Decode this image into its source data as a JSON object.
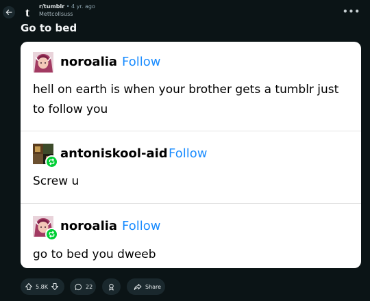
{
  "header": {
    "subreddit": "r/tumblr",
    "separator": "•",
    "age": "4 yr. ago",
    "author": "Mettcollsuss",
    "more": "•••"
  },
  "post": {
    "title": "Go to bed"
  },
  "tumblr": {
    "follow_label": "Follow",
    "blocks": [
      {
        "username": "noroalia",
        "text_line1": "hell on earth is when your brother gets a tumblr just",
        "text_line2": "to follow you"
      },
      {
        "username": "antoniskool-aid",
        "text": "Screw u"
      },
      {
        "username": "noroalia",
        "text": "go to bed you dweeb"
      }
    ]
  },
  "actions": {
    "score": "5.8K",
    "comments": "22",
    "share": "Share"
  },
  "colors": {
    "background": "#0b1416",
    "pill": "#1a282d",
    "follow_blue": "#1a8cff",
    "reblog_green": "#00cf35"
  }
}
